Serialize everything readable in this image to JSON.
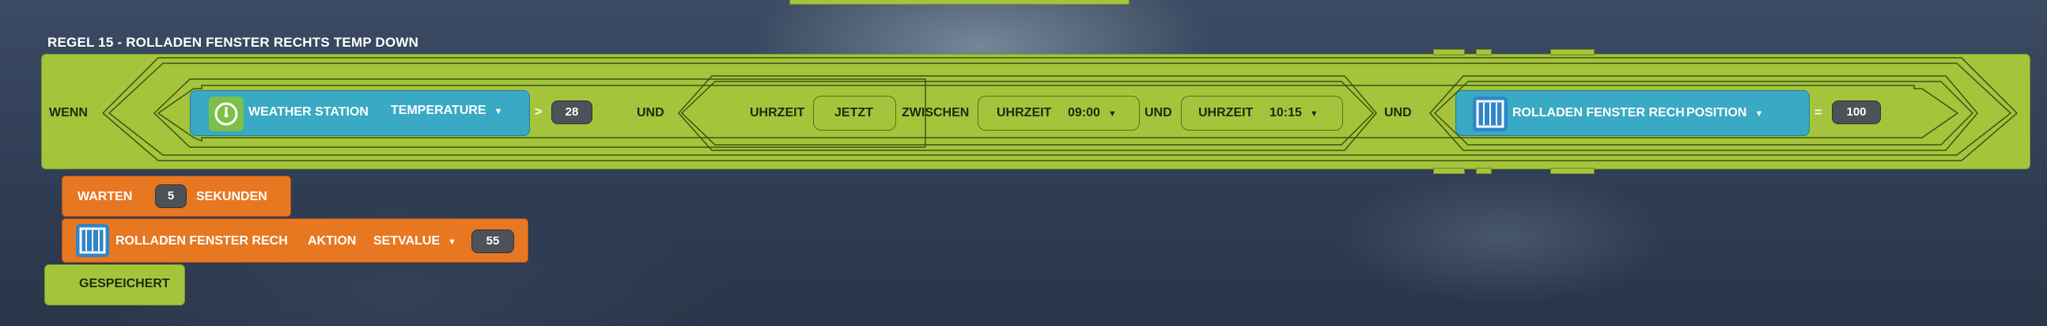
{
  "rule": {
    "title": "REGEL 15 - ROLLADEN FENSTER RECHTS TEMP DOWN",
    "wenn_label": "WENN",
    "condition1": {
      "device_name": "WEATHER STATION",
      "property": "TEMPERATURE",
      "operator": ">",
      "value": "28",
      "icon": "gauge-icon"
    },
    "und1": "UND",
    "condition2": {
      "label_uhrzeit": "UHRZEIT",
      "now_label": "JETZT",
      "between_label": "ZWISCHEN",
      "from_label": "UHRZEIT",
      "from_time": "09:00",
      "and_label": "UND",
      "to_label": "UHRZEIT",
      "to_time": "10:15"
    },
    "und2": "UND",
    "condition3": {
      "device_name": "ROLLADEN FENSTER RECH",
      "property": "POSITION",
      "operator": "=",
      "value": "100",
      "icon": "window-blind-icon"
    }
  },
  "actions": {
    "wait": {
      "label": "WARTEN",
      "value": "5",
      "unit": "SEKUNDEN"
    },
    "set": {
      "device_name": "ROLLADEN FENSTER RECH",
      "action_label": "AKTION",
      "action": "SETVALUE",
      "value": "55",
      "icon": "window-blind-icon"
    },
    "saved_label": "GESPEICHERT"
  },
  "colors": {
    "green": "#a4c53b",
    "orange": "#e87722",
    "device_blue": "#3aa9c4",
    "number_bg": "#4d5258"
  }
}
